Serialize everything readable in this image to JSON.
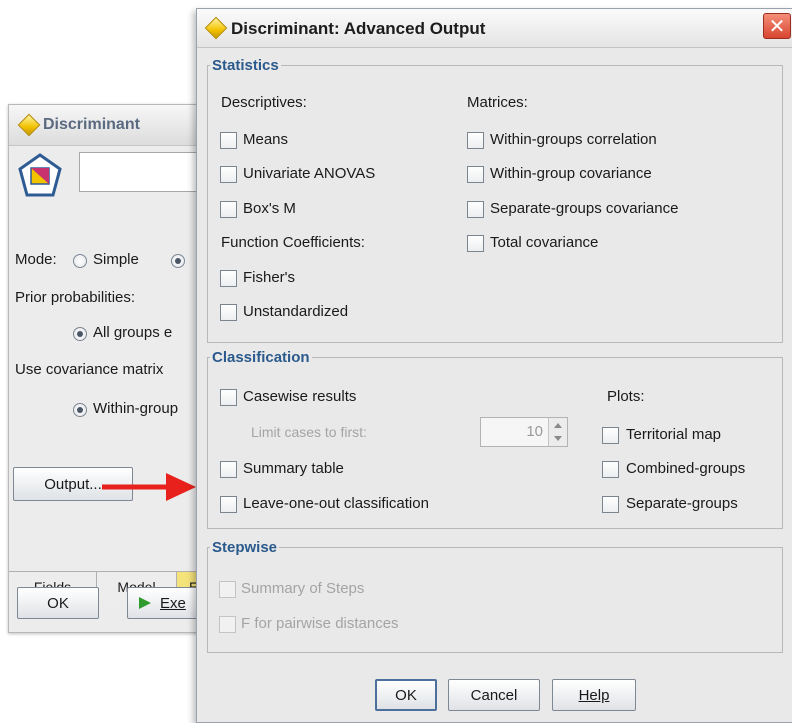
{
  "background_window": {
    "title": "Discriminant",
    "mode_label": "Mode:",
    "mode_option_simple": "Simple",
    "prior_label": "Prior probabilities:",
    "prior_option": "All groups e",
    "covariance_label": "Use covariance matrix",
    "covariance_option": "Within-group",
    "output_button": "Output...",
    "tabs": [
      "Fields",
      "Model",
      "E"
    ],
    "ok_button": "OK",
    "execute_button": "Exe"
  },
  "dialog": {
    "title": "Discriminant: Advanced Output",
    "statistics": {
      "legend": "Statistics",
      "descriptives_heading": "Descriptives:",
      "means": "Means",
      "univariate": "Univariate ANOVAS",
      "boxm": "Box's M",
      "function_heading": "Function Coefficients:",
      "fisher": "Fisher's",
      "unstandardized": "Unstandardized",
      "matrices_heading": "Matrices:",
      "within_corr": "Within-groups correlation",
      "within_cov": "Within-group covariance",
      "separate_cov": "Separate-groups covariance",
      "total_cov": "Total covariance"
    },
    "classification": {
      "legend": "Classification",
      "casewise": "Casewise results",
      "limit_label": "Limit cases to first:",
      "limit_value": "10",
      "summary": "Summary table",
      "leave_one_out": "Leave-one-out classification",
      "plots_heading": "Plots:",
      "territorial": "Territorial map",
      "combined": "Combined-groups",
      "separate": "Separate-groups"
    },
    "stepwise": {
      "legend": "Stepwise",
      "summary_steps": "Summary of Steps",
      "f_pairwise": "F for pairwise distances"
    },
    "buttons": {
      "ok": "OK",
      "cancel": "Cancel",
      "help": "Help"
    }
  },
  "colors": {
    "legend_blue": "#2b5a8c",
    "arrow_red": "#e8211c",
    "close_red": "#d94530"
  }
}
